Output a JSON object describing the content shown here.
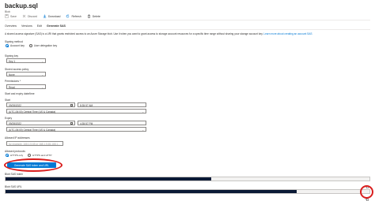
{
  "header": {
    "title": "backup.sql",
    "subtitle": "Blob"
  },
  "toolbar": {
    "save": "Save",
    "discard": "Discard",
    "download": "Download",
    "refresh": "Refresh",
    "delete": "Delete"
  },
  "tabs": {
    "overview": "Overview",
    "versions": "Versions",
    "edit": "Edit",
    "generate_sas": "Generate SAS"
  },
  "description": {
    "text": "A shared access signature (SAS) is a URI that grants restricted access to an Azure Storage blob. Use it when you want to grant access to storage account resources for a specific time range without sharing your storage account key.",
    "link": "Learn more about creating an account SAS"
  },
  "signing_method": {
    "label": "Signing method",
    "option1": "Account key",
    "option2": "User delegation key",
    "selected": "Account key"
  },
  "signing_key": {
    "label": "Signing key",
    "value": "Key 1"
  },
  "stored_policy": {
    "label": "Stored access policy",
    "value": "None"
  },
  "permissions": {
    "label": "Permissions *",
    "value": "Read"
  },
  "time_section": {
    "label": "Start and expiry date/time"
  },
  "start": {
    "label": "Start",
    "date": "09/28/2022",
    "time": "8:35:57 AM",
    "timezone": "(UTC-06:00) Central Time (US & Canada)"
  },
  "expiry": {
    "label": "Expiry",
    "date": "09/28/2022",
    "time": "4:35:57 PM",
    "timezone": "(UTC-06:00) Central Time (US & Canada)"
  },
  "allowed_ip": {
    "label": "Allowed IP addresses",
    "placeholder": "for example, 168.1.5.65 or 168.1.5.65-168.1..."
  },
  "allowed_protocols": {
    "label": "Allowed protocols",
    "option1": "HTTPS only",
    "option2": "HTTPS and HTTP",
    "selected": "HTTPS only"
  },
  "generate_button": "Generate SAS token and URL",
  "blob_sas_token": {
    "label": "Blob SAS token"
  },
  "blob_sas_url": {
    "label": "Blob SAS URL"
  },
  "colors": {
    "accent": "#0078d4",
    "annotation": "#d91e1e",
    "redaction": "#0b1a36"
  }
}
